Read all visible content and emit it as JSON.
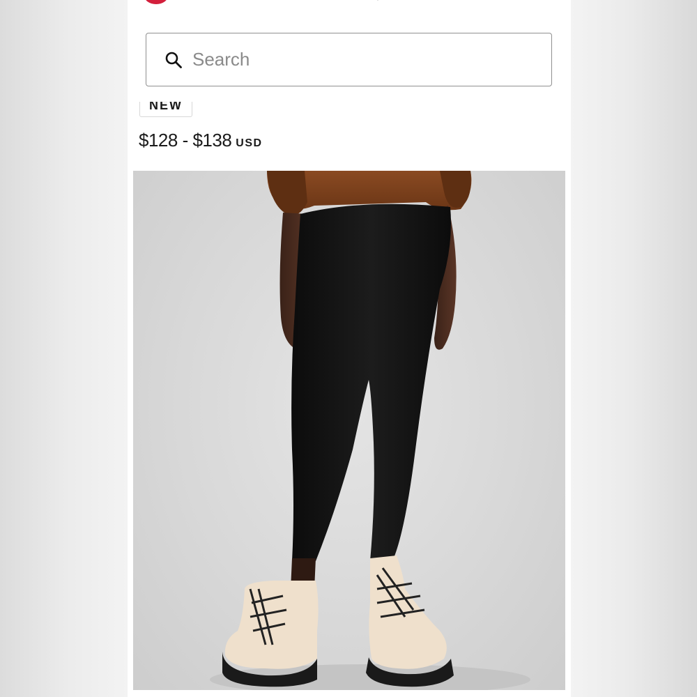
{
  "colors": {
    "brand_red": "#d31f3b",
    "text": "#1a1a1a",
    "placeholder": "#8a8a8a",
    "border": "#8f8f8f"
  },
  "nav": {
    "icons": [
      "lululemon-logo",
      "account-icon",
      "location-icon",
      "wishlist-icon",
      "store-icon",
      "bag-icon"
    ]
  },
  "search": {
    "placeholder": "Search",
    "value": ""
  },
  "product": {
    "badge": "NEW",
    "price_range": "$128 - $138",
    "currency": "USD",
    "image_alt": "model-wearing-black-leggings"
  }
}
